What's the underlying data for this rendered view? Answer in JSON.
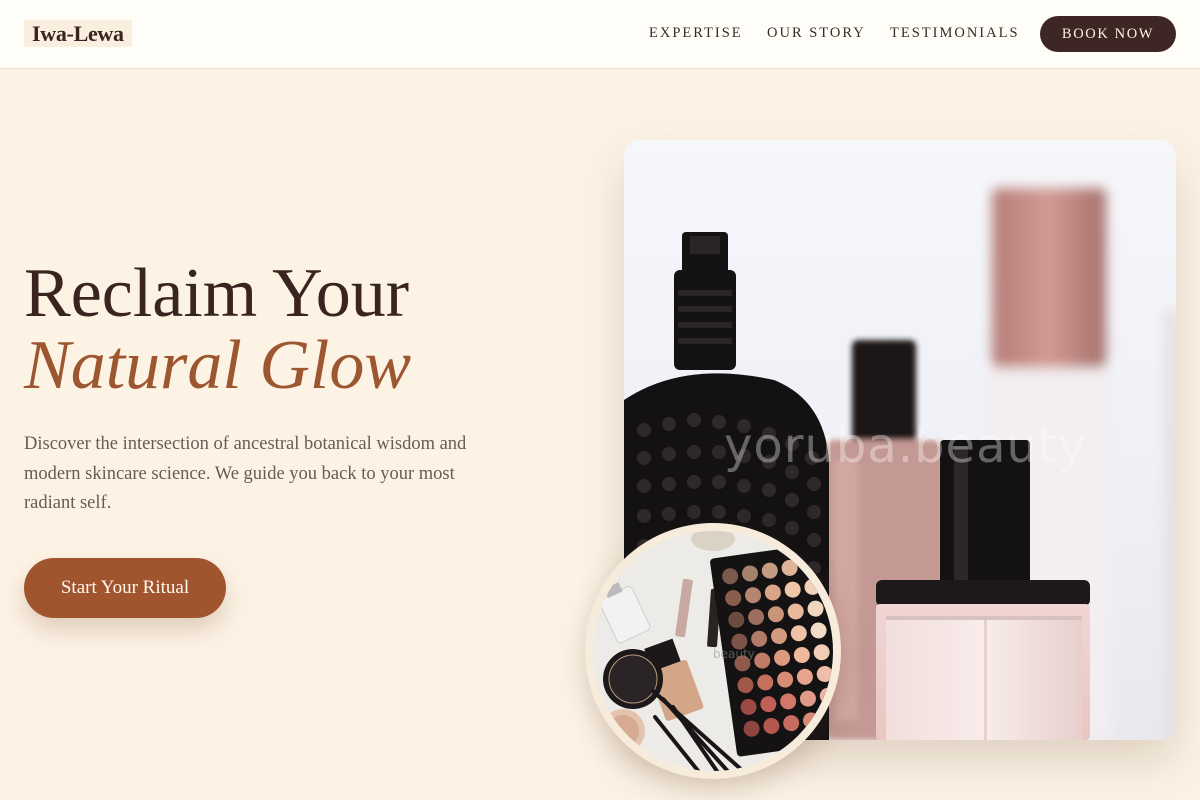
{
  "brand": {
    "logo": "Iwa-Lewa"
  },
  "nav": {
    "links": [
      "EXPERTISE",
      "OUR STORY",
      "TESTIMONIALS"
    ],
    "cta": "BOOK NOW"
  },
  "hero": {
    "title_line1": "Reclaim Your",
    "title_line2": "Natural Glow",
    "description": "Discover the intersection of ancestral botanical wisdom and modern skincare science. We guide you back to your most radiant self.",
    "cta": "Start Your Ritual",
    "image_watermark": "yoruba.beauty",
    "small_image_watermark": "beauty"
  },
  "colors": {
    "background": "#fdf3e5",
    "dark_brown": "#3d2623",
    "accent": "#a0552f",
    "accent_text": "#9c5630"
  },
  "icons": {
    "main_image": "perfume-bottles-photo",
    "circle_image": "makeup-palette-photo"
  }
}
